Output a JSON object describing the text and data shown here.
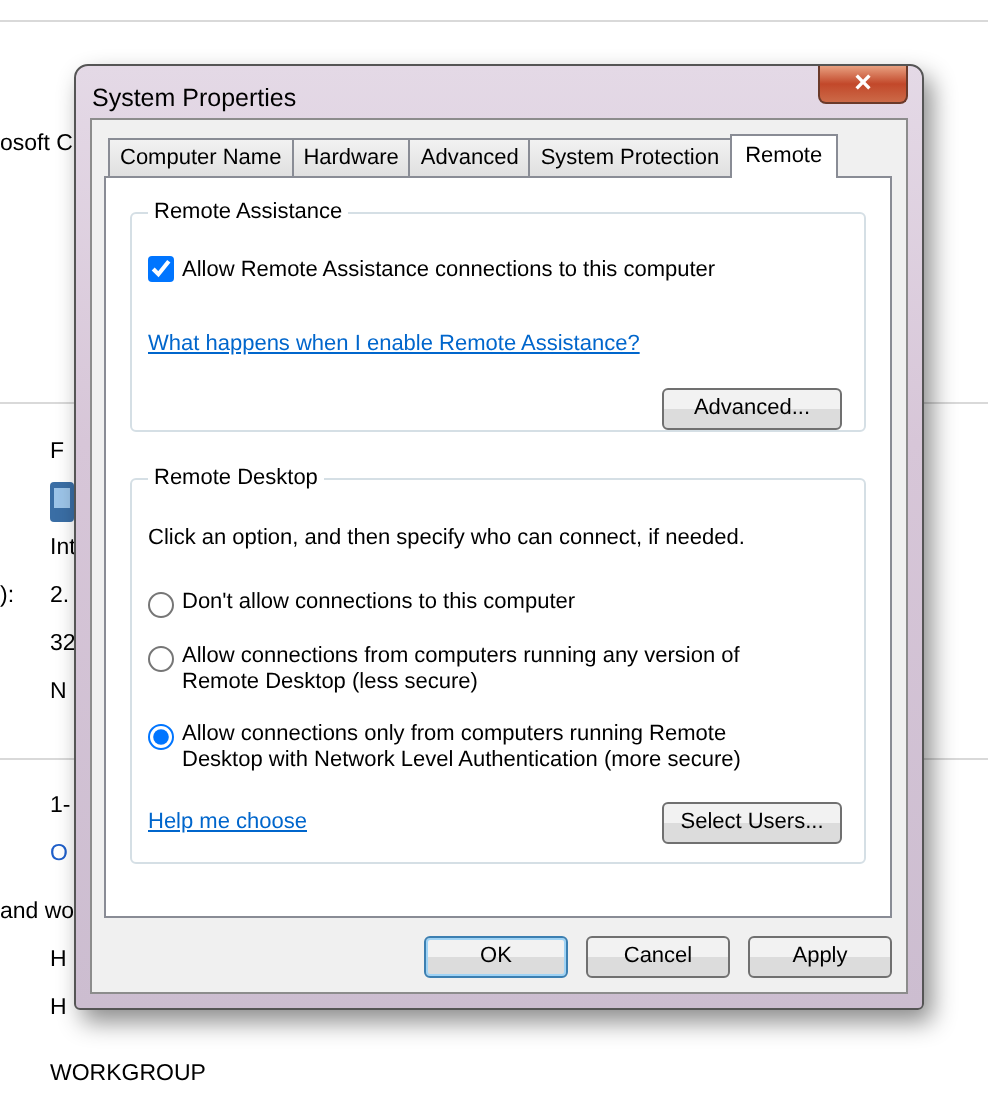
{
  "background_window": {
    "sections": [
      {
        "rows": [
          {
            "kind": "text",
            "label": "osoft C"
          }
        ]
      },
      {
        "rows": [
          {
            "kind": "text",
            "value": "F"
          },
          {
            "kind": "icon"
          },
          {
            "kind": "text",
            "value": "Int"
          },
          {
            "kind": "text",
            "label": "):",
            "value": "2."
          },
          {
            "kind": "text",
            "value": "32"
          },
          {
            "kind": "text",
            "value": "N"
          }
        ]
      },
      {
        "rows": [
          {
            "kind": "text",
            "value": "1-"
          },
          {
            "kind": "link",
            "value": "O"
          }
        ]
      },
      {
        "rows": [
          {
            "kind": "text",
            "label": "and wo"
          },
          {
            "kind": "text",
            "value": "H"
          },
          {
            "kind": "text",
            "value": "H"
          },
          {
            "kind": "text",
            "value": "WORKGROUP"
          }
        ]
      }
    ]
  },
  "dialog": {
    "title": "System Properties",
    "close": "×",
    "tabs": [
      {
        "label": "Computer Name",
        "selected": false
      },
      {
        "label": "Hardware",
        "selected": false
      },
      {
        "label": "Advanced",
        "selected": false
      },
      {
        "label": "System Protection",
        "selected": false
      },
      {
        "label": "Remote",
        "selected": true
      }
    ],
    "remote_assistance": {
      "title": "Remote Assistance",
      "allow_checkbox": {
        "label": "Allow Remote Assistance connections to this computer",
        "checked": true
      },
      "help_link": "What happens when I enable Remote Assistance?",
      "advanced_button": "Advanced..."
    },
    "remote_desktop": {
      "title": "Remote Desktop",
      "instruction": "Click an option, and then specify who can connect, if needed.",
      "options": [
        {
          "label": "Don't allow connections to this computer",
          "selected": false
        },
        {
          "label": "Allow connections from computers running any version of Remote Desktop (less secure)",
          "selected": false
        },
        {
          "label": "Allow connections only from computers running Remote Desktop with Network Level Authentication (more secure)",
          "selected": true
        }
      ],
      "help_link": "Help me choose",
      "select_users_button": "Select Users..."
    },
    "buttons": [
      {
        "label": "OK",
        "default": true
      },
      {
        "label": "Cancel",
        "default": false
      },
      {
        "label": "Apply",
        "default": false
      }
    ]
  }
}
